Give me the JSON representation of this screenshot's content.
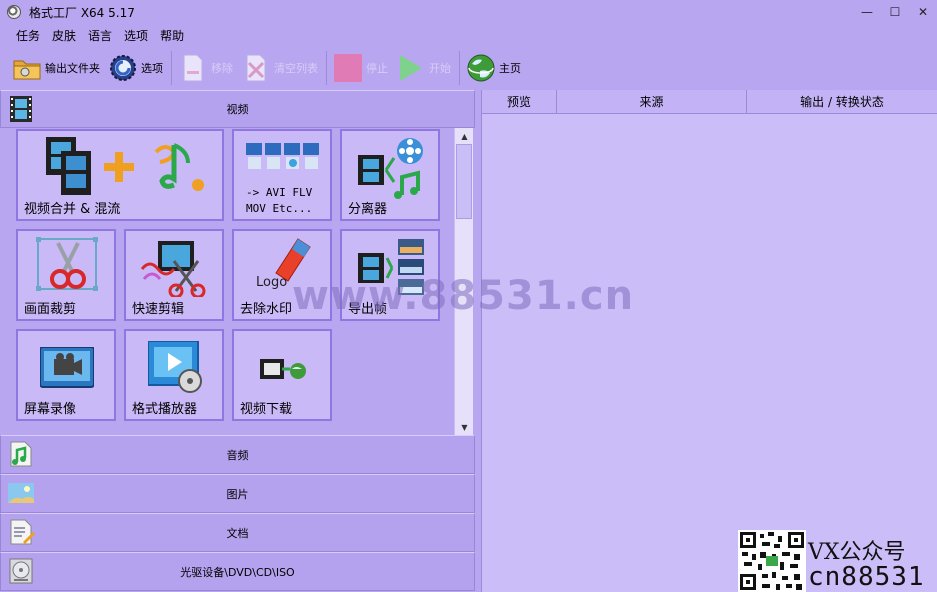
{
  "window": {
    "title": "格式工厂 X64 5.17",
    "controls": [
      "—",
      "☐",
      "✕"
    ]
  },
  "menu": [
    "任务",
    "皮肤",
    "语言",
    "选项",
    "帮助"
  ],
  "toolbar": {
    "output_folder": "输出文件夹",
    "options": "选项",
    "remove": "移除",
    "clear_list": "清空列表",
    "stop": "停止",
    "start": "开始",
    "home": "主页"
  },
  "categories": {
    "video": "视频",
    "audio": "音频",
    "picture": "图片",
    "document": "文档",
    "optical": "光驱设备\\DVD\\CD\\ISO"
  },
  "tiles": {
    "merge": "视频合并 & 混流",
    "convert_line1": "-> AVI FLV",
    "convert_line2": "MOV Etc...",
    "splitter": "分离器",
    "crop": "画面裁剪",
    "quick_clip": "快速剪辑",
    "remove_logo": "去除水印",
    "logo_word": "Logo",
    "export_frames": "导出帧",
    "screen_record": "屏幕录像",
    "player": "格式播放器",
    "download": "视频下载"
  },
  "table": {
    "columns": [
      "预览",
      "来源",
      "输出 / 转换状态"
    ]
  },
  "watermark": {
    "site": "www.88531.cn",
    "vx": "VX公众号",
    "cn": "cn88531"
  },
  "colors": {
    "background": "#b9a6f0",
    "tile": "#c9b9f7",
    "tile_border": "#9076e0",
    "right_panel": "#cbbdf8"
  }
}
